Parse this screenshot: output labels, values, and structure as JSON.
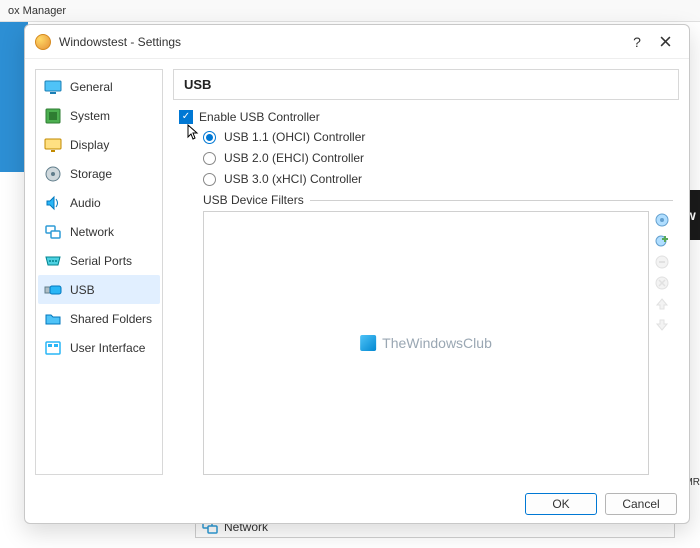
{
  "bg": {
    "titlebar_fragment": "ox Manager",
    "right_dark_text": "ow",
    "oemr_text": "_OEMR",
    "network_label": "Network"
  },
  "dialog": {
    "title": "Windowstest - Settings",
    "help_symbol": "?",
    "sidebar": {
      "items": [
        {
          "key": "general",
          "label": "General"
        },
        {
          "key": "system",
          "label": "System"
        },
        {
          "key": "display",
          "label": "Display"
        },
        {
          "key": "storage",
          "label": "Storage"
        },
        {
          "key": "audio",
          "label": "Audio"
        },
        {
          "key": "network",
          "label": "Network"
        },
        {
          "key": "serialports",
          "label": "Serial Ports"
        },
        {
          "key": "usb",
          "label": "USB"
        },
        {
          "key": "sharedfolders",
          "label": "Shared Folders"
        },
        {
          "key": "userinterface",
          "label": "User Interface"
        }
      ],
      "selected": "usb"
    },
    "panel": {
      "title": "USB",
      "enable_label": "Enable USB Controller",
      "enable_checked": true,
      "radio_selected": "usb11",
      "radios": [
        {
          "key": "usb11",
          "label": "USB 1.1 (OHCI) Controller"
        },
        {
          "key": "usb20",
          "label": "USB 2.0 (EHCI) Controller"
        },
        {
          "key": "usb30",
          "label": "USB 3.0 (xHCI) Controller"
        }
      ],
      "filters_label": "USB Device Filters",
      "watermark": "TheWindowsClub"
    },
    "buttons": {
      "ok": "OK",
      "cancel": "Cancel"
    }
  }
}
